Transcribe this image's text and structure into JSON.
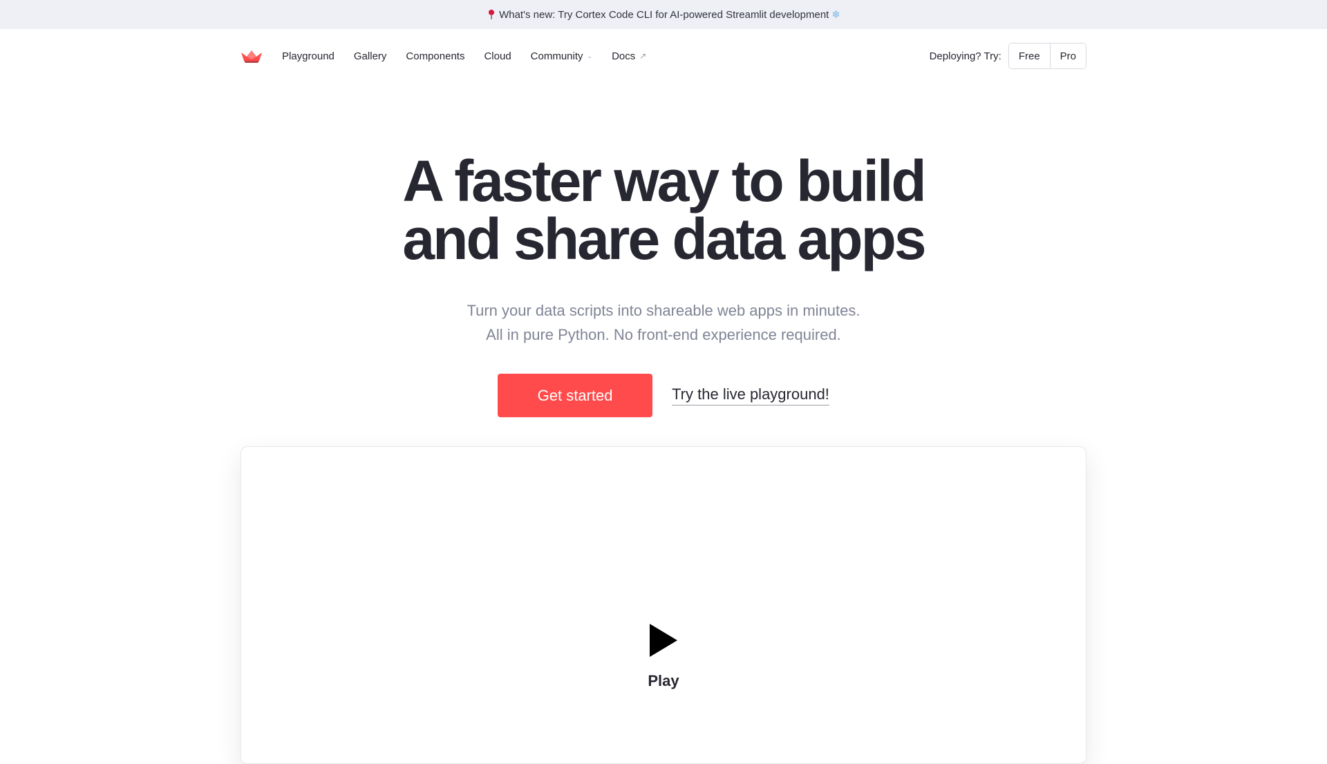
{
  "banner": {
    "text": "What's new: Try Cortex Code CLI for AI-powered Streamlit development",
    "pin_icon": "pin-icon",
    "flake_glyph": "❄"
  },
  "nav": {
    "logo_icon": "streamlit-crown-logo",
    "links": [
      {
        "label": "Playground"
      },
      {
        "label": "Gallery"
      },
      {
        "label": "Components"
      },
      {
        "label": "Cloud"
      },
      {
        "label": "Community",
        "dropdown": true
      },
      {
        "label": "Docs",
        "external": true
      }
    ],
    "deploy_label": "Deploying? Try:",
    "free_label": "Free",
    "pro_label": "Pro"
  },
  "hero": {
    "title_line1": "A faster way to build",
    "title_line2": "and share data apps",
    "subtitle_line1": "Turn your data scripts into shareable web apps in minutes.",
    "subtitle_line2": "All in pure Python. No front-end experience required.",
    "primary_cta": "Get started",
    "secondary_cta": "Try the live playground!"
  },
  "video": {
    "play_label": "Play"
  },
  "colors": {
    "accent": "#ff4b4b",
    "text": "#262730",
    "muted": "#808495",
    "banner_bg": "#eef0f5"
  }
}
